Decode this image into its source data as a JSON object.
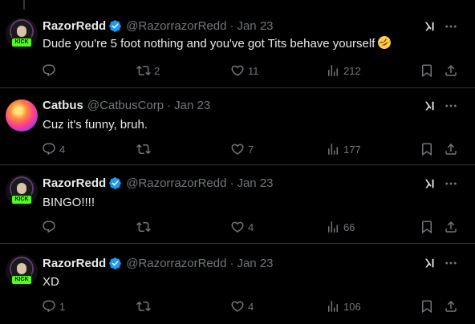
{
  "colors": {
    "background": "#000000",
    "text": "#e7e9ea",
    "muted": "#71767b",
    "divider": "#2f3336",
    "verified": "#1d9bf0"
  },
  "tweets": [
    {
      "name": "RazorRedd",
      "handle": "@RazorrazorRedd",
      "separator": "·",
      "date": "Jan 23",
      "verified": true,
      "avatar": "razorredd-avatar",
      "text": "Dude you're 5 foot nothing and you've got Tits behave yourself",
      "emoji": "rolling-on-floor-laughing-emoji",
      "replies": "",
      "reposts": "2",
      "likes": "11",
      "views": "212"
    },
    {
      "name": "Catbus",
      "handle": "@CatbusCorp",
      "separator": "·",
      "date": "Jan 23",
      "verified": false,
      "avatar": "catbus-avatar",
      "text": "Cuz it's funny, bruh.",
      "replies": "4",
      "reposts": "",
      "likes": "7",
      "views": "177"
    },
    {
      "name": "RazorRedd",
      "handle": "@RazorrazorRedd",
      "separator": "·",
      "date": "Jan 23",
      "verified": true,
      "avatar": "razorredd-avatar",
      "text": "BINGO!!!!",
      "replies": "",
      "reposts": "",
      "likes": "4",
      "views": "66"
    },
    {
      "name": "RazorRedd",
      "handle": "@RazorrazorRedd",
      "separator": "·",
      "date": "Jan 23",
      "verified": true,
      "avatar": "razorredd-avatar",
      "text": "XD",
      "replies": "1",
      "reposts": "",
      "likes": "4",
      "views": "106"
    }
  ],
  "avatar_badge": "KICK",
  "icons": [
    "verified-badge-icon",
    "grok-icon",
    "more-icon",
    "reply-icon",
    "repost-icon",
    "like-icon",
    "views-icon",
    "bookmark-icon",
    "share-icon"
  ]
}
